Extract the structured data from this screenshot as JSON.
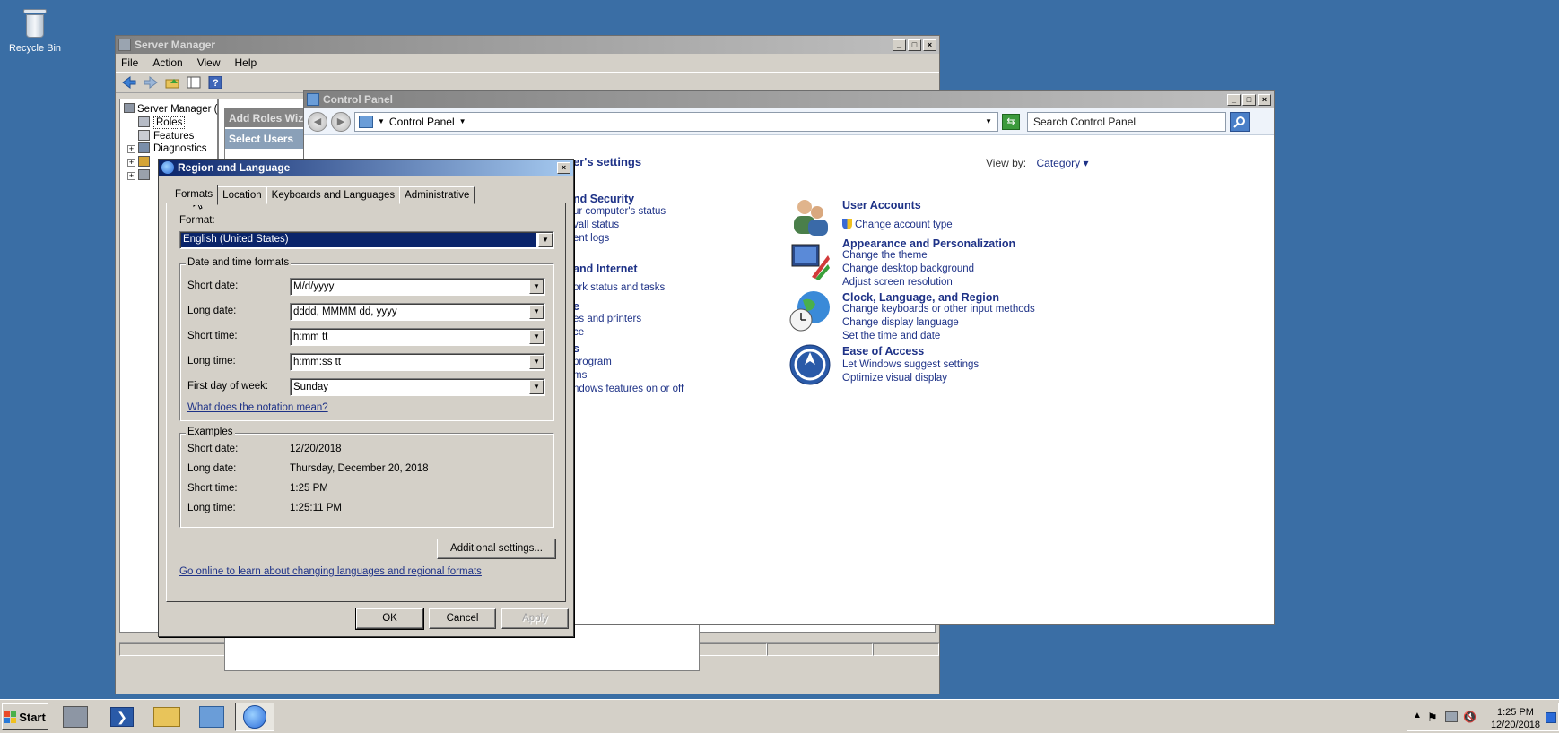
{
  "desktop": {
    "recycle_bin_label": "Recycle Bin"
  },
  "server_manager": {
    "title": "Server Manager",
    "menu": [
      "File",
      "Action",
      "View",
      "Help"
    ],
    "tree": {
      "root": "Server Manager (IE...",
      "items": [
        "Roles",
        "Features",
        "Diagnostics"
      ]
    },
    "wizard": {
      "title": "Add Roles Wiz",
      "step": "Select Users"
    }
  },
  "control_panel": {
    "title": "Control Panel",
    "address": "Control Panel",
    "search_placeholder": "Search Control Panel",
    "heading": "er's settings",
    "view_by_label": "View by:",
    "view_by_value": "Category",
    "left_fragments": [
      {
        "text": "nd Security",
        "head": true
      },
      {
        "text": "ur computer's status",
        "head": false
      },
      {
        "text": "vall status",
        "head": false
      },
      {
        "text": "ent logs",
        "head": false
      },
      {
        "text": "and Internet",
        "head": true
      },
      {
        "text": "ork status and tasks",
        "head": false
      },
      {
        "text": "e",
        "head": true
      },
      {
        "text": "es and printers",
        "head": false
      },
      {
        "text": "ce",
        "head": false
      },
      {
        "text": "s",
        "head": true
      },
      {
        "text": "program",
        "head": false
      },
      {
        "text": "ms",
        "head": false
      },
      {
        "text": "ndows features on or off",
        "head": false
      }
    ],
    "categories": [
      {
        "title": "User Accounts",
        "links": [
          "Change account type"
        ],
        "icon": "users-icon"
      },
      {
        "title": "Appearance and Personalization",
        "links": [
          "Change the theme",
          "Change desktop background",
          "Adjust screen resolution"
        ],
        "icon": "appearance-icon"
      },
      {
        "title": "Clock, Language, and Region",
        "links": [
          "Change keyboards or other input methods",
          "Change display language",
          "Set the time and date"
        ],
        "icon": "globe-clock-icon"
      },
      {
        "title": "Ease of Access",
        "links": [
          "Let Windows suggest settings",
          "Optimize visual display"
        ],
        "icon": "ease-of-access-icon"
      }
    ]
  },
  "region_dialog": {
    "title": "Region and Language",
    "tabs": [
      "Formats",
      "Location",
      "Keyboards and Languages",
      "Administrative"
    ],
    "selected_tab": "Formats",
    "format_label": "Format:",
    "format_value": "English (United States)",
    "datetime_group_title": "Date and time formats",
    "fields": [
      {
        "label": "Short date:",
        "value": "M/d/yyyy"
      },
      {
        "label": "Long date:",
        "value": "dddd, MMMM dd, yyyy"
      },
      {
        "label": "Short time:",
        "value": "h:mm tt"
      },
      {
        "label": "Long time:",
        "value": "h:mm:ss tt"
      },
      {
        "label": "First day of week:",
        "value": "Sunday"
      }
    ],
    "notation_link": "What does the notation mean?",
    "examples_title": "Examples",
    "examples": [
      {
        "label": "Short date:",
        "value": "12/20/2018"
      },
      {
        "label": "Long date:",
        "value": "Thursday, December 20, 2018"
      },
      {
        "label": "Short time:",
        "value": "1:25 PM"
      },
      {
        "label": "Long time:",
        "value": "1:25:11 PM"
      }
    ],
    "additional_button": "Additional settings...",
    "online_link": "Go online to learn about changing languages and regional formats",
    "ok": "OK",
    "cancel": "Cancel",
    "apply": "Apply"
  },
  "taskbar": {
    "start_label": "Start",
    "time": "1:25 PM",
    "date": "12/20/2018"
  }
}
